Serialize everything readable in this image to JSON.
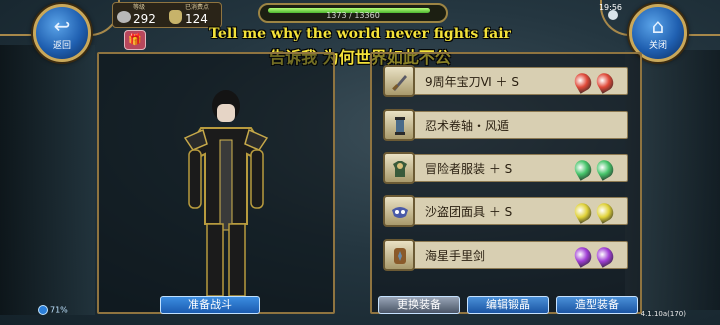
{
  "hud": {
    "back_label": "返回",
    "close_label": "关闭",
    "level_caption": "等级",
    "level_value": "292",
    "points_caption": "已消费点",
    "points_value": "124",
    "hp_text": "1373 / 13360",
    "hp_fraction": 0.95,
    "clock": "19:56"
  },
  "caption": {
    "english": "Tell me why the world never fights fair",
    "chinese": "告诉我 为何世界如此不公"
  },
  "character": {
    "ready_button": "准备战斗"
  },
  "equipment": [
    {
      "name": "9周年宝刀Ⅵ ＋ S",
      "icon": "sword-icon",
      "gem_color": "#e04a3a",
      "gems": 2
    },
    {
      "name": "忍术卷轴・风遁",
      "icon": "scroll-icon",
      "gem_color": "",
      "gems": 0
    },
    {
      "name": "冒险者服装 ＋ S",
      "icon": "armor-icon",
      "gem_color": "#46c46a",
      "gems": 2
    },
    {
      "name": "沙盗团面具 ＋ S",
      "icon": "mask-icon",
      "gem_color": "#e0d23a",
      "gems": 2
    },
    {
      "name": "海星手里剑",
      "icon": "shuriken-icon",
      "gem_color": "#a13fd6",
      "gems": 2
    }
  ],
  "actions": {
    "swap_label": "更换装备",
    "crystal_label": "编辑锻晶",
    "style_label": "造型装备"
  },
  "footer": {
    "signal": "71%",
    "version": "4.1.10a(170)"
  },
  "colors": {
    "frame_gold": "#8f7440",
    "button_blue": "#1a5bb0",
    "caption_yellow": "#f3e23a"
  }
}
